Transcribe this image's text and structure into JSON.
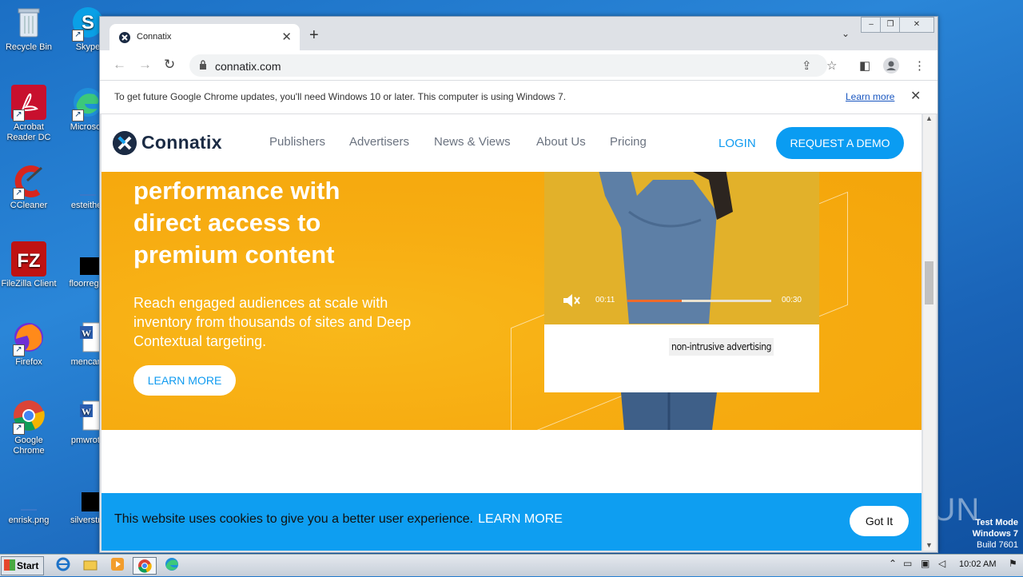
{
  "desktop": {
    "icons": [
      {
        "label": "Recycle Bin",
        "icon": "recycle-bin-icon"
      },
      {
        "label": "Skype",
        "icon": "skype-icon"
      },
      {
        "label": "Acrobat Reader DC",
        "icon": "acrobat-icon"
      },
      {
        "label": "Microsoft",
        "icon": "edge-icon"
      },
      {
        "label": "CCleaner",
        "icon": "ccleaner-icon"
      },
      {
        "label": "esteither",
        "icon": "file-icon"
      },
      {
        "label": "FileZilla Client",
        "icon": "filezilla-icon"
      },
      {
        "label": "floorregar",
        "icon": "file-icon"
      },
      {
        "label": "Firefox",
        "icon": "firefox-icon"
      },
      {
        "label": "mencare",
        "icon": "word-doc-icon"
      },
      {
        "label": "Google Chrome",
        "icon": "chrome-icon"
      },
      {
        "label": "pmwrote",
        "icon": "word-doc-icon"
      },
      {
        "label": "enrisk.png",
        "icon": "image-file-icon"
      },
      {
        "label": "silverstru",
        "icon": "file-icon"
      }
    ]
  },
  "browser": {
    "tab_title": "Connatix",
    "tab_close": "✕",
    "new_tab": "+",
    "url": "connatix.com",
    "infobar": {
      "message": "To get future Google Chrome updates, you'll need Windows 10 or later. This computer is using Windows 7.",
      "link": "Learn more",
      "close": "✕"
    }
  },
  "site": {
    "logo": "Connatix",
    "nav": [
      "Publishers",
      "Advertisers",
      "News & Views",
      "About Us",
      "Pricing"
    ],
    "login": "LOGIN",
    "demo": "REQUEST A DEMO",
    "hero": {
      "headline": [
        "performance with",
        "direct access to",
        "premium content"
      ],
      "sub": "Reach engaged audiences at scale with inventory from thousands of sites and Deep Contextual targeting.",
      "button": "LEARN MORE"
    },
    "video": {
      "time_current": "00:11",
      "time_total": "00:30",
      "progress": 0.38,
      "caption": "non-intrusive advertising"
    },
    "cookie": {
      "message": "This website uses cookies to give you a better user experience.",
      "learn": "LEARN MORE",
      "button": "Got It"
    }
  },
  "watermark": "ANY RUN",
  "test_mode": [
    "Test Mode",
    "Windows 7",
    "Build 7601"
  ],
  "taskbar": {
    "start": "Start",
    "clock": "10:02 AM"
  }
}
